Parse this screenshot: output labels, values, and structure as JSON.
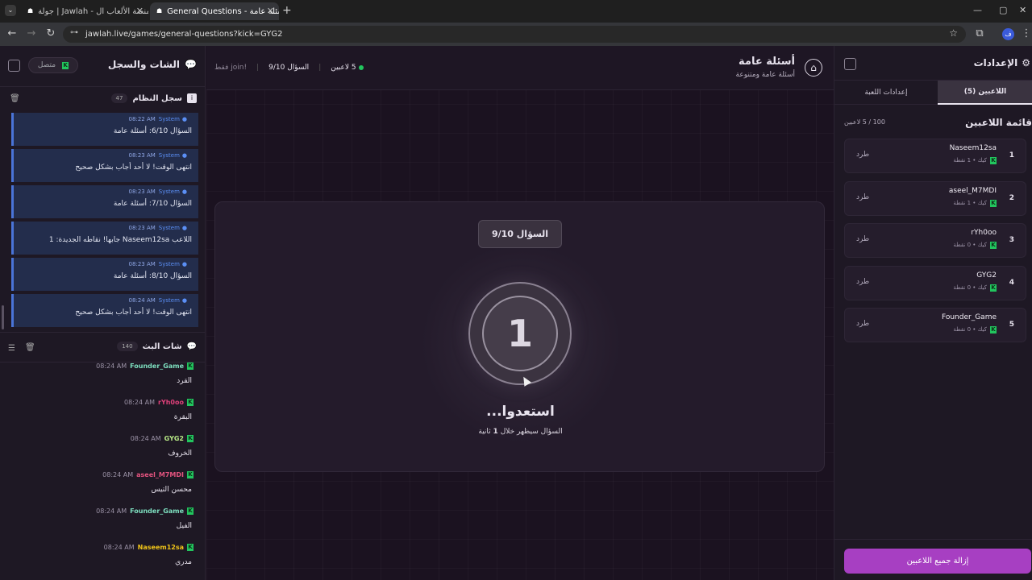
{
  "browser": {
    "tabs": [
      {
        "title": "جولة | Jawlah - منصة الألعاب ال..."
      },
      {
        "title": "General Questions - أسئلة عامة"
      }
    ],
    "url": "jawlah.live/games/general-questions?kick=GYG2"
  },
  "chat_panel": {
    "title": "الشات والسجل",
    "connection_status": "متصل",
    "system_log": {
      "title": "سجل النظام",
      "count": "47",
      "messages": [
        {
          "sender": "System",
          "time": "08:22 AM",
          "text": "السؤال 6/10: أسئلة عامة"
        },
        {
          "sender": "System",
          "time": "08:23 AM",
          "text": "انتهى الوقت! لا أحد أجاب بشكل صحيح"
        },
        {
          "sender": "System",
          "time": "08:23 AM",
          "text": "السؤال 7/10: أسئلة عامة"
        },
        {
          "sender": "System",
          "time": "08:23 AM",
          "text": "اللاعب Naseem12sa جابها! نقاطه الجديدة: 1"
        },
        {
          "sender": "System",
          "time": "08:23 AM",
          "text": "السؤال 8/10: أسئلة عامة"
        },
        {
          "sender": "System",
          "time": "08:24 AM",
          "text": "انتهى الوقت! لا أحد أجاب بشكل صحيح"
        }
      ]
    },
    "live_chat": {
      "title": "شات البث",
      "count": "140",
      "messages": [
        {
          "user": "Founder_Game",
          "time": "08:24 AM",
          "text": "القرد",
          "color": "#7ee0c0"
        },
        {
          "user": "rYh0oo",
          "time": "08:24 AM",
          "text": "البقرة",
          "color": "#e0407a"
        },
        {
          "user": "GYG2",
          "time": "08:24 AM",
          "text": "الخروف",
          "color": "#b8e986"
        },
        {
          "user": "aseel_M7MDI",
          "time": "08:24 AM",
          "text": "محسن التيس",
          "color": "#e2537e"
        },
        {
          "user": "Founder_Game",
          "time": "08:24 AM",
          "text": "الفيل",
          "color": "#7ee0c0"
        },
        {
          "user": "Naseem12sa",
          "time": "08:24 AM",
          "text": "مدري",
          "color": "#f0c419"
        }
      ]
    }
  },
  "header": {
    "title": "أسئلة عامة",
    "subtitle": "أسئلة عامة ومتنوعة",
    "players_count": "5 لاعبين",
    "question_progress": "السؤال 9/10",
    "mode": "!join فقط"
  },
  "stage": {
    "question_label": "السؤال 9/10",
    "countdown": "1",
    "heading": "استعدوا...",
    "subtext_before": "السؤال سيظهر خلال",
    "subtext_num": "1",
    "subtext_after": "ثانية"
  },
  "settings_panel": {
    "title": "الإعدادات",
    "tabs": [
      {
        "label": "اللاعبين (5)",
        "active": true
      },
      {
        "label": "إعدادات اللعبة",
        "active": false
      }
    ],
    "players_list_title": "قائمة اللاعبين",
    "players_capacity": "100 / 5 لاعبين",
    "kick_label": "طرد",
    "players": [
      {
        "rank": "1",
        "name": "Naseem12sa",
        "platform": "كيك",
        "points": "1 نقطة"
      },
      {
        "rank": "2",
        "name": "aseel_M7MDI",
        "platform": "كيك",
        "points": "1 نقطة"
      },
      {
        "rank": "3",
        "name": "rYh0oo",
        "platform": "كيك",
        "points": "0 نقطة"
      },
      {
        "rank": "4",
        "name": "GYG2",
        "platform": "كيك",
        "points": "0 نقطة"
      },
      {
        "rank": "5",
        "name": "Founder_Game",
        "platform": "كيك",
        "points": "0 نقطة"
      }
    ],
    "remove_all_button": "إزالة جميع اللاعبين"
  }
}
